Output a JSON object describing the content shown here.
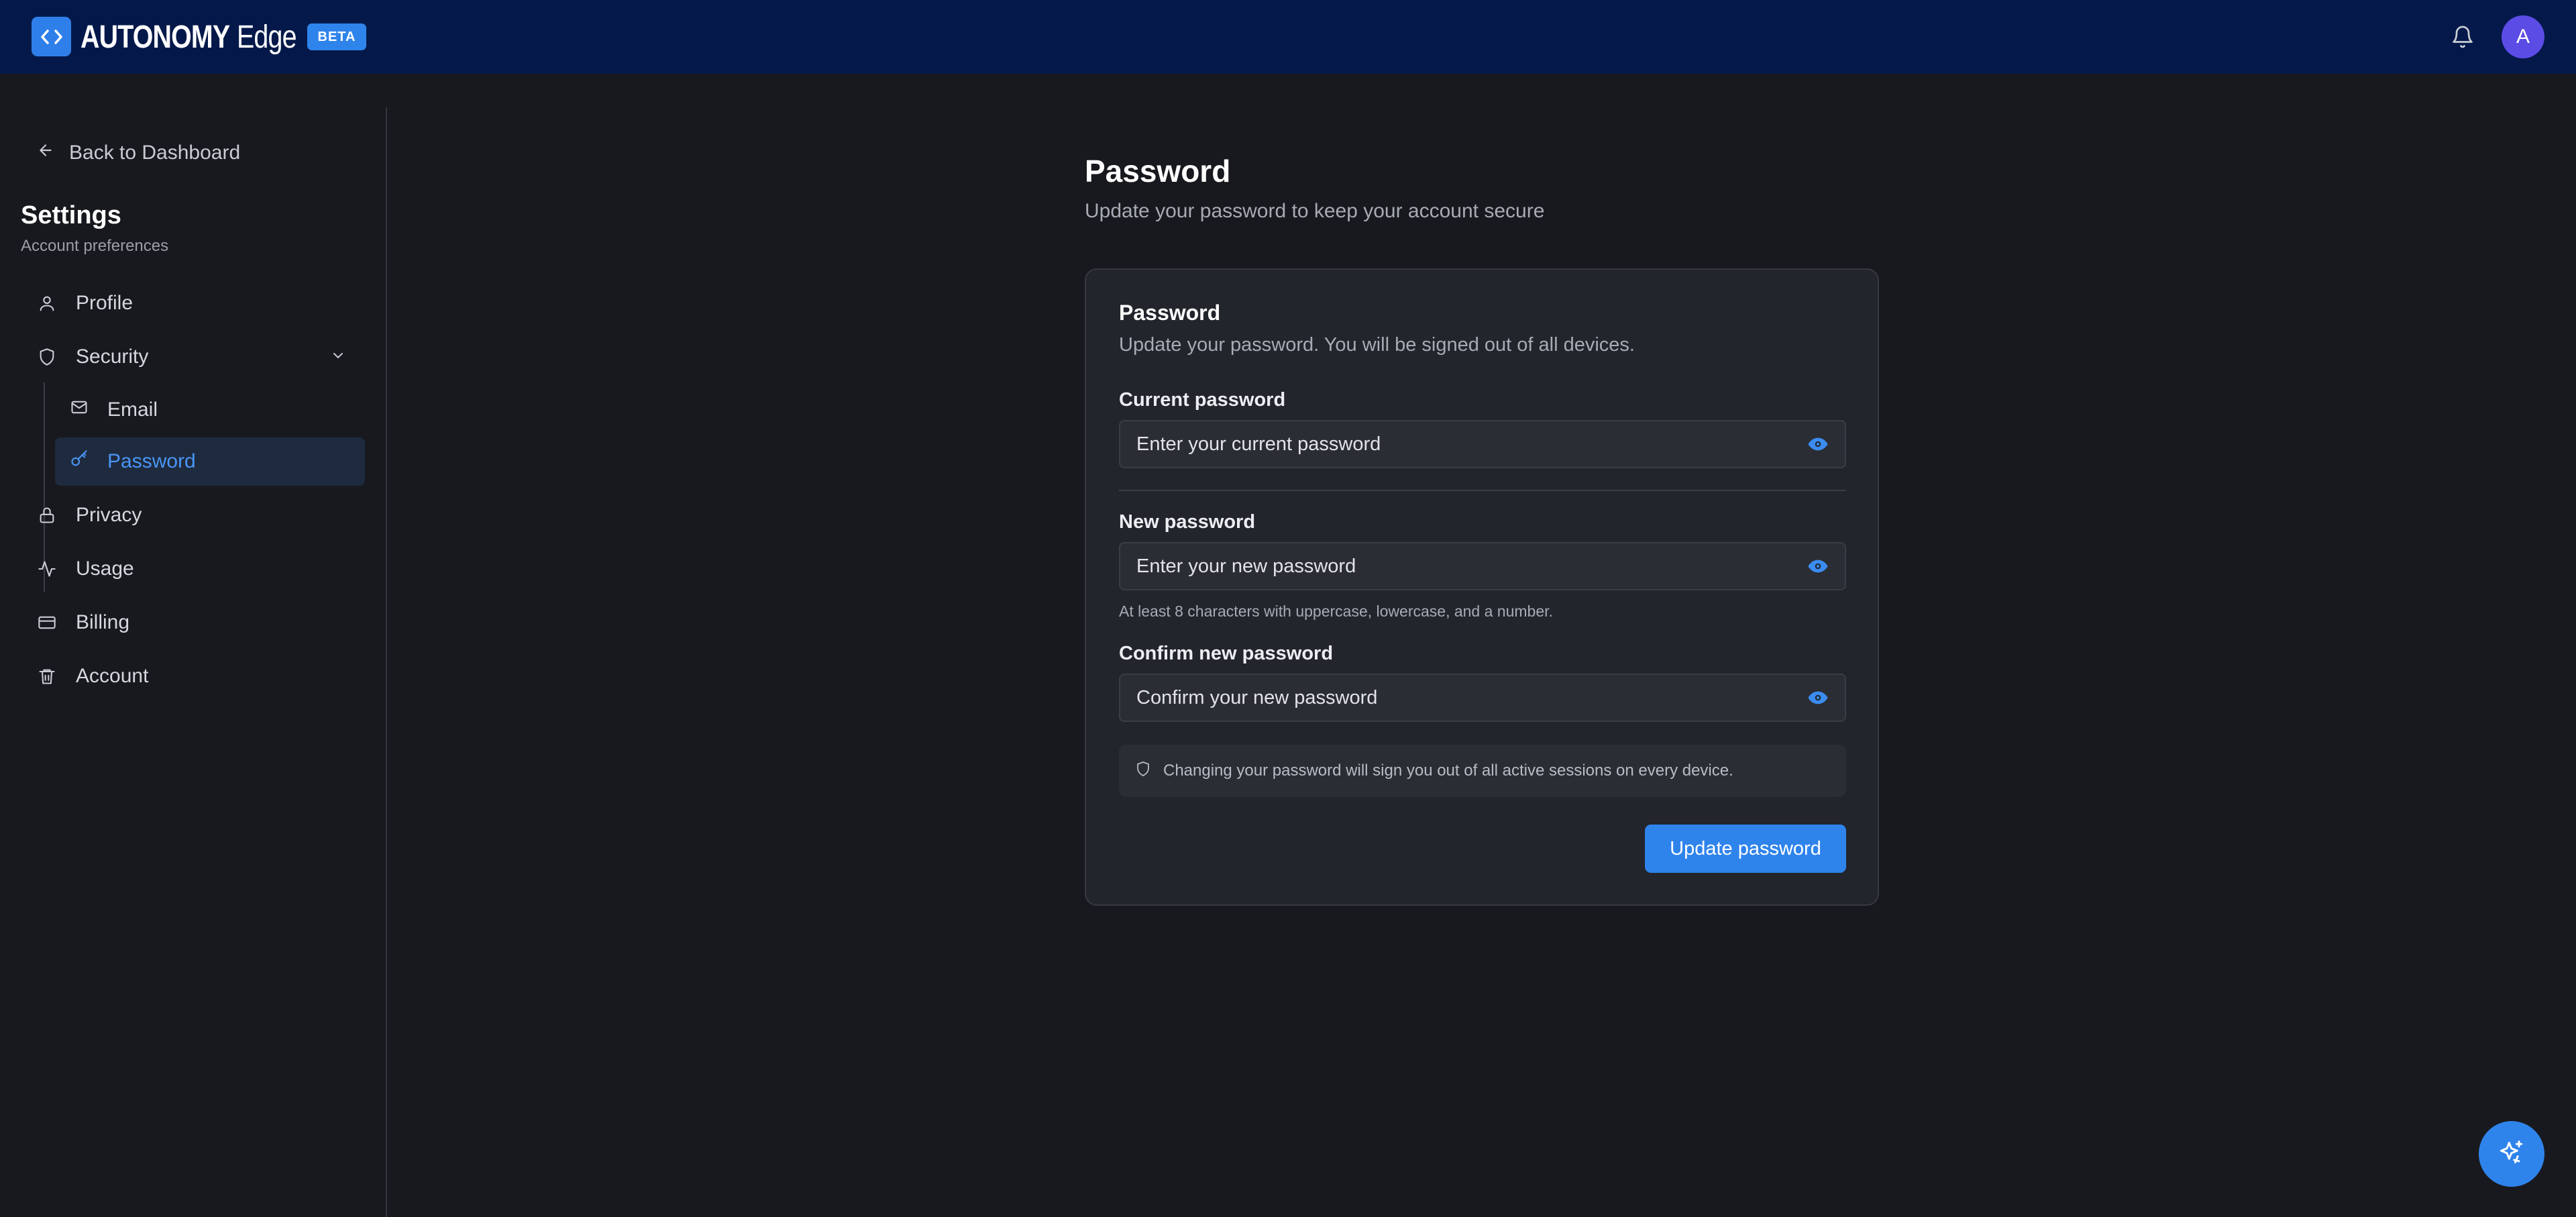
{
  "app": {
    "brand_strong": "AUTONOMY",
    "brand_light": "Edge",
    "badge": "BETA",
    "avatar_initial": "A"
  },
  "sidebar": {
    "back_label": "Back to Dashboard",
    "title": "Settings",
    "subtitle": "Account preferences",
    "items": [
      {
        "label": "Profile",
        "icon": "user-icon"
      },
      {
        "label": "Security",
        "icon": "shield-icon",
        "expanded": true
      },
      {
        "label": "Privacy",
        "icon": "lock-icon"
      },
      {
        "label": "Usage",
        "icon": "activity-icon"
      },
      {
        "label": "Billing",
        "icon": "credit-card-icon"
      },
      {
        "label": "Account",
        "icon": "trash-icon"
      }
    ],
    "security_sub": [
      {
        "label": "Email",
        "icon": "mail-icon"
      },
      {
        "label": "Password",
        "icon": "key-icon",
        "active": true
      }
    ]
  },
  "main": {
    "title": "Password",
    "subtitle": "Update your password to keep your account secure",
    "card": {
      "title": "Password",
      "subtitle": "Update your password. You will be signed out of all devices.",
      "current_label": "Current password",
      "current_placeholder": "Enter your current password",
      "new_label": "New password",
      "new_placeholder": "Enter your new password",
      "new_hint": "At least 8 characters with uppercase, lowercase, and a number.",
      "confirm_label": "Confirm new password",
      "confirm_placeholder": "Confirm your new password",
      "notice": "Changing your password will sign you out of all active sessions on every device.",
      "submit_label": "Update password"
    }
  },
  "colors": {
    "topbar": "#04194a",
    "accent": "#2f84ec",
    "background": "#18191e",
    "card": "#22252c",
    "active_nav_bg": "#1e2a3d",
    "active_nav_text": "#4a95f5"
  }
}
